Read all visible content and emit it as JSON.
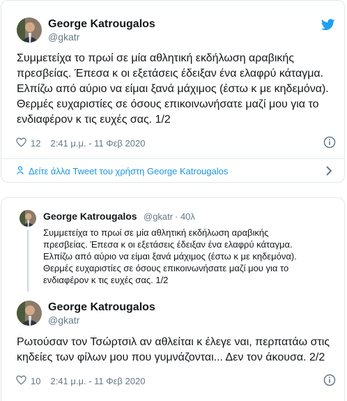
{
  "tweet1": {
    "name": "George Katrougalos",
    "handle": "@gkatr",
    "text": "Συμμετείχα το πρωί σε μία αθλητική εκδήλωση αραβικής\nπρεσβείας. Έπεσα κ οι εξετάσεις έδειξαν ένα ελαφρύ κάταγμα.\nΕλπίζω από αύριο να είμαι ξανά μάχιμος (έστω κ με κηδεμόνα).\nΘερμές ευχαριστίες σε όσους επικοινωνήσατε μαζί μου για το\nενδιαφέρον κ τις ευχές σας. 1/2",
    "likes": "12",
    "timestamp": "2:41 μ.μ. - 11 Φεβ 2020",
    "more_link": "Δείτε άλλα Tweet του χρήστη George Katrougalos"
  },
  "reply": {
    "name": "George Katrougalos",
    "handle": "@gkatr",
    "age": "· 40λ",
    "text": "Συμμετείχα το πρωί σε μία αθλητική εκδήλωση αραβικής\nπρεσβείας. Έπεσα κ οι εξετάσεις έδειξαν ένα ελαφρύ κάταγμα.\nΕλπίζω από αύριο να είμαι ξανά μάχιμος (έστω κ με κηδεμόνα).\nΘερμές ευχαριστίες σε όσους επικοινωνήσατε μαζί μου για το\nενδιαφέρον κ τις ευχές σας. 1/2"
  },
  "tweet2": {
    "name": "George Katrougalos",
    "handle": "@gkatr",
    "text": "Ρωτούσαν τον Τσώρτσιλ αν αθλείται κ έλεγε ναι, περπατάω στις\nκηδείες των φίλων μου που γυμνάζονται... Δεν τον άκουσα. 2/2",
    "likes": "10",
    "timestamp": "2:41 μ.μ. - 11 Φεβ 2020"
  },
  "colors": {
    "twitter_blue": "#1da1f2",
    "link_blue": "#1b95e0",
    "muted": "#657786"
  },
  "icons": [
    "twitter-bird-icon",
    "heart-icon",
    "info-icon",
    "chevron-right-icon"
  ]
}
